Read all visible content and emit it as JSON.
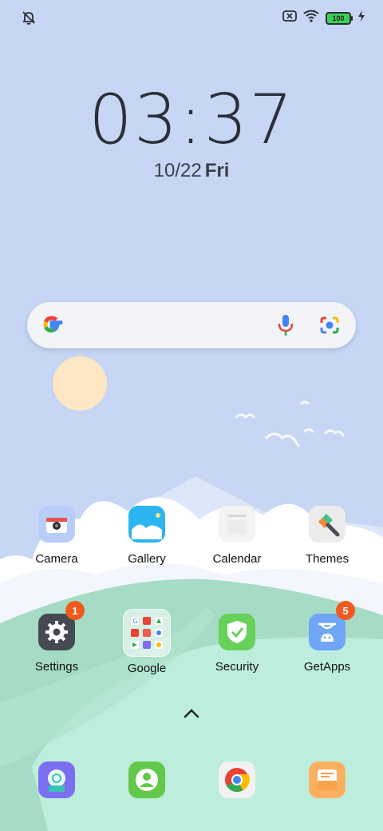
{
  "status_bar": {
    "left_icon": "bell-muted-icon",
    "right_icons": [
      "sim-x-icon",
      "wifi-icon"
    ],
    "battery_level": "100",
    "charging_icon": "bolt-icon"
  },
  "lock": {
    "time": "03:37",
    "date": "10/22",
    "weekday": "Fri"
  },
  "search_bar": {
    "logo": "google-g-icon",
    "voice_icon": "microphone-icon",
    "lens_icon": "lens-camera-icon"
  },
  "apps_row1": [
    {
      "label": "Camera",
      "icon": "camera-icon"
    },
    {
      "label": "Gallery",
      "icon": "gallery-icon"
    },
    {
      "label": "Calendar",
      "icon": "calendar-icon"
    },
    {
      "label": "Themes",
      "icon": "brush-icon"
    }
  ],
  "apps_row2": [
    {
      "label": "Settings",
      "icon": "gear-icon",
      "badge": "1"
    },
    {
      "label": "Google",
      "icon": "folder-icon"
    },
    {
      "label": "Security",
      "icon": "shield-icon"
    },
    {
      "label": "GetApps",
      "icon": "shopping-bag-icon",
      "badge": "5"
    }
  ],
  "dock": [
    "browser-icon",
    "contacts-icon",
    "chrome-icon",
    "notes-icon"
  ],
  "drawer_handle": "chevron-up-icon",
  "colors": {
    "sky": "#c6d6f4",
    "hill": "#b6ebd9",
    "badge": "#f05a1f"
  }
}
